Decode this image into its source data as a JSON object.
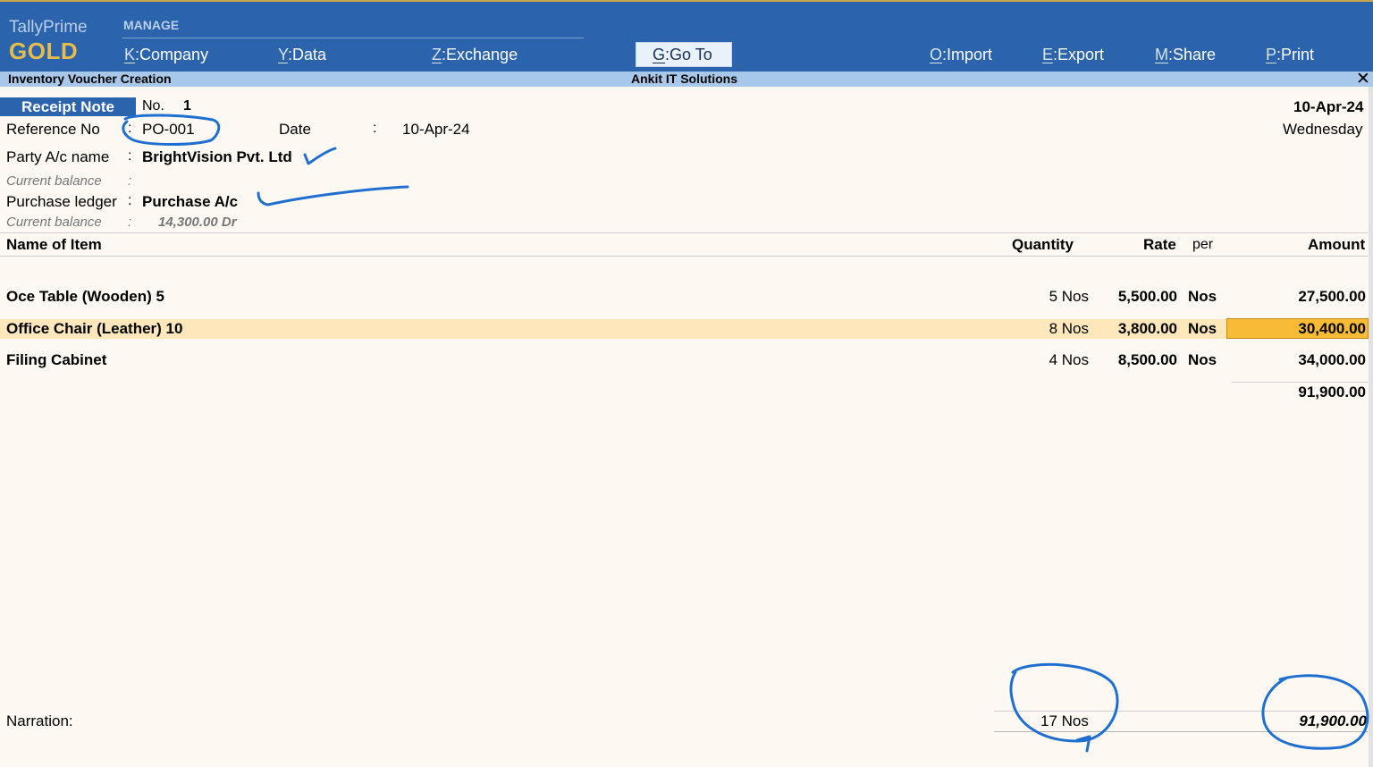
{
  "app": {
    "name": "TallyPrime",
    "tier": "GOLD"
  },
  "menu": {
    "section_label": "MANAGE",
    "items": [
      {
        "key": "K",
        "label": "Company"
      },
      {
        "key": "Y",
        "label": "Data"
      },
      {
        "key": "Z",
        "label": "Exchange"
      },
      {
        "key": "G",
        "label": "Go To"
      },
      {
        "key": "O",
        "label": "Import"
      },
      {
        "key": "E",
        "label": "Export"
      },
      {
        "key": "M",
        "label": "Share"
      },
      {
        "key": "P",
        "label": "Print"
      }
    ]
  },
  "titlebar": {
    "screen_title": "Inventory Voucher Creation",
    "company": "Ankit IT Solutions",
    "close_icon": "close-icon"
  },
  "voucher": {
    "type": "Receipt Note",
    "no_label": "No.",
    "no_value": "1",
    "date_top": "10-Apr-24",
    "weekday": "Wednesday",
    "reference_label": "Reference No",
    "colon": ":",
    "reference_value": "PO-001",
    "date_label": "Date",
    "date_value": "10-Apr-24",
    "party_label": "Party A/c name",
    "party_value": "BrightVision Pvt. Ltd",
    "current_balance_label": "Current balance",
    "purchase_label": "Purchase ledger",
    "purchase_value": "Purchase A/c",
    "purchase_balance": "14,300.00 Dr"
  },
  "table": {
    "headers": {
      "name": "Name of Item",
      "quantity": "Quantity",
      "rate": "Rate",
      "per": "per",
      "amount": "Amount"
    },
    "rows": [
      {
        "name": "Oce Table (Wooden) 5",
        "quantity": "5 Nos",
        "rate": "5,500.00",
        "per": "Nos",
        "amount": "27,500.00"
      },
      {
        "name": "Office Chair (Leather) 10",
        "quantity": "8 Nos",
        "rate": "3,800.00",
        "per": "Nos",
        "amount": "30,400.00"
      },
      {
        "name": "Filing Cabinet",
        "quantity": "4 Nos",
        "rate": "8,500.00",
        "per": "Nos",
        "amount": "34,000.00"
      }
    ],
    "subtotal": "91,900.00"
  },
  "footer": {
    "narration_label": "Narration:",
    "total_quantity": "17 Nos",
    "total_amount": "91,900.00"
  },
  "colors": {
    "topbar": "#2b63ad",
    "gold": "#e6bd4c",
    "titlebar": "#a8c8ea",
    "focus": "#f7bb36",
    "highlight_row": "#fde7bb",
    "ink": "#1f6fd0"
  }
}
